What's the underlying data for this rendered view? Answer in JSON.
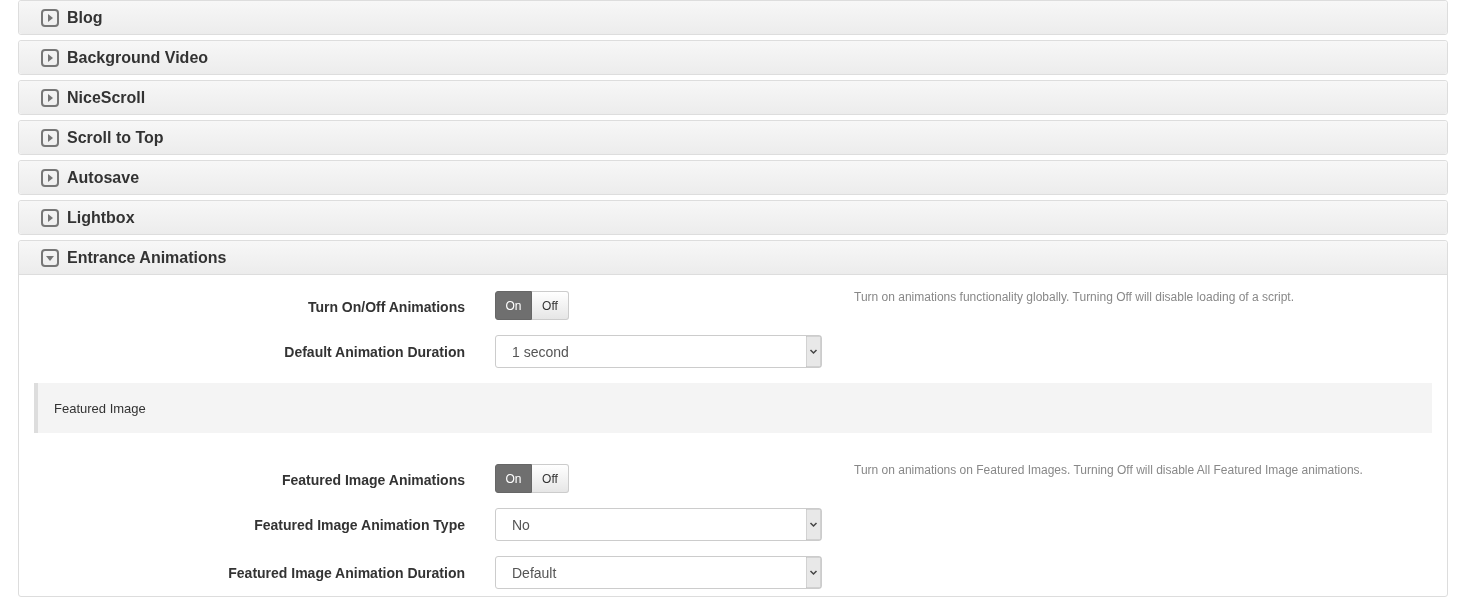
{
  "sections": [
    {
      "title": "Blog",
      "expanded": false
    },
    {
      "title": "Background Video",
      "expanded": false
    },
    {
      "title": "NiceScroll",
      "expanded": false
    },
    {
      "title": "Scroll to Top",
      "expanded": false
    },
    {
      "title": "Autosave",
      "expanded": false
    },
    {
      "title": "Lightbox",
      "expanded": false
    },
    {
      "title": "Entrance Animations",
      "expanded": true,
      "items": [
        {
          "kind": "toggle",
          "label": "Turn On/Off Animations",
          "options": [
            {
              "label": "On",
              "selected": true
            },
            {
              "label": "Off",
              "selected": false
            }
          ],
          "description": "Turn on animations functionality globally. Turning Off will disable loading of a script."
        },
        {
          "kind": "select",
          "label": "Default Animation Duration",
          "value": "1 second"
        },
        {
          "kind": "heading",
          "label": "Featured Image"
        },
        {
          "kind": "toggle",
          "label": "Featured Image Animations",
          "options": [
            {
              "label": "On",
              "selected": true
            },
            {
              "label": "Off",
              "selected": false
            }
          ],
          "description": "Turn on animations on Featured Images. Turning Off will disable All Featured Image animations."
        },
        {
          "kind": "select",
          "label": "Featured Image Animation Type",
          "value": "No"
        },
        {
          "kind": "select",
          "label": "Featured Image Animation Duration",
          "value": "Default"
        }
      ]
    }
  ]
}
